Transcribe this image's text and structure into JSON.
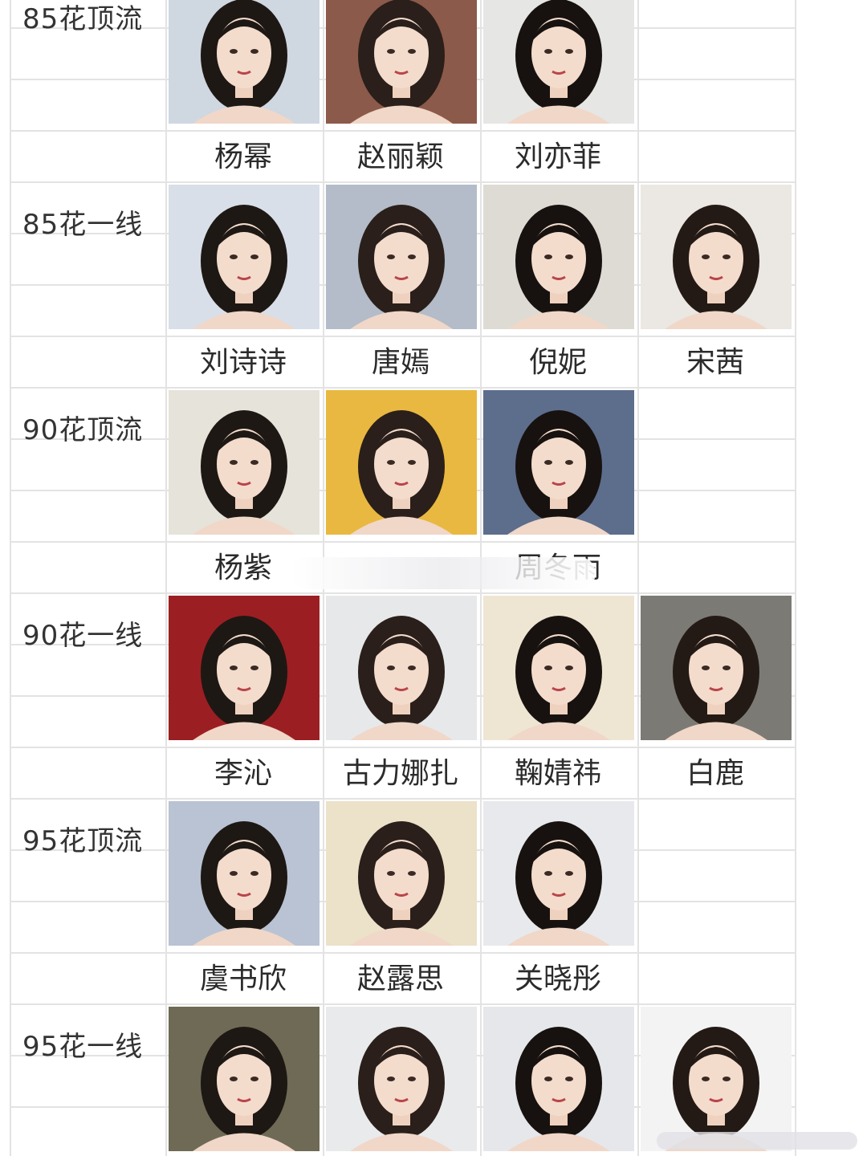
{
  "tiers": [
    {
      "label": "85花顶流",
      "names": [
        "杨幂",
        "赵丽颖",
        "刘亦菲",
        ""
      ],
      "tones": [
        "#cfd7e1",
        "#8c5a4a",
        "#e6e6e4",
        ""
      ]
    },
    {
      "label": "85花一线",
      "names": [
        "刘诗诗",
        "唐嫣",
        "倪妮",
        "宋茜"
      ],
      "tones": [
        "#d9dfe8",
        "#b3bcc8",
        "#dedbd4",
        "#ebe7e2"
      ]
    },
    {
      "label": "90花顶流",
      "names": [
        "杨紫",
        "",
        "周冬雨",
        ""
      ],
      "tones": [
        "#e6e3da",
        "#e9b840",
        "#5d6d8c",
        ""
      ]
    },
    {
      "label": "90花一线",
      "names": [
        "李沁",
        "古力娜扎",
        "鞠婧祎",
        "白鹿"
      ],
      "tones": [
        "#9b1f22",
        "#e7e8ea",
        "#eee6d3",
        "#7c7a74"
      ]
    },
    {
      "label": "95花顶流",
      "names": [
        "虞书欣",
        "赵露思",
        "关晓彤",
        ""
      ],
      "tones": [
        "#b9c3d3",
        "#ece1c9",
        "#e8e9ec",
        ""
      ]
    },
    {
      "label": "95花一线",
      "names": [],
      "tones": [
        "#6e6a55",
        "#e9eaec",
        "#e6e7ea",
        "#f3f3f3"
      ]
    }
  ],
  "icons": {
    "portrait": "portrait-photo"
  }
}
